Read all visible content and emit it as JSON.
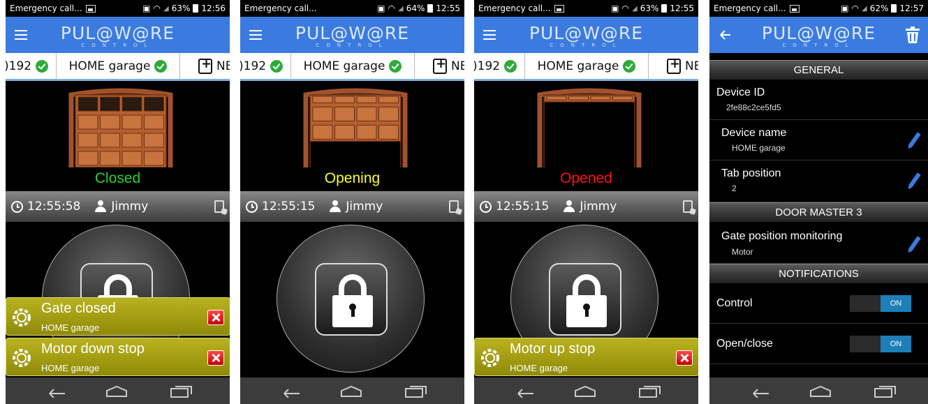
{
  "status_bar": {
    "carrier": "Emergency call...",
    "screens": [
      {
        "battery": "63%",
        "time": "12:56"
      },
      {
        "battery": "64%",
        "time": "12:55"
      },
      {
        "battery": "63%",
        "time": "12:55"
      },
      {
        "battery": "62%",
        "time": "12:57"
      }
    ]
  },
  "app": {
    "logo_main": "PUL@W@RE",
    "logo_sub": "CONTROL",
    "brand_color": "#3b7be0"
  },
  "tabs": {
    "left_partial": ")192",
    "active": "HOME garage",
    "right_partial": "NE"
  },
  "screens": [
    {
      "state": "Closed",
      "state_color": "#2bd12b",
      "door_open_fraction": 0,
      "time": "12:55:58",
      "user": "Jimmy",
      "notifications": [
        {
          "title": "Gate closed",
          "subtitle": "HOME garage"
        },
        {
          "title": "Motor down stop",
          "subtitle": "HOME garage"
        }
      ]
    },
    {
      "state": "Opening",
      "state_color": "#ffff1e",
      "door_open_fraction": 0.4,
      "time": "12:55:15",
      "user": "Jimmy",
      "notifications": []
    },
    {
      "state": "Opened",
      "state_color": "#ff1010",
      "door_open_fraction": 1,
      "time": "12:55:15",
      "user": "Jimmy",
      "notifications": [
        {
          "title": "Motor up stop",
          "subtitle": "HOME garage"
        }
      ]
    }
  ],
  "settings": {
    "general_header": "GENERAL",
    "device_id_label": "Device ID",
    "device_id_value": "2fe88c2ce5fd5",
    "device_name_label": "Device name",
    "device_name_value": "HOME garage",
    "tab_position_label": "Tab position",
    "tab_position_value": "2",
    "door_master_header": "DOOR MASTER 3",
    "gate_monitoring_label": "Gate position monitoring",
    "gate_monitoring_value": "Motor",
    "notifications_header": "NOTIFICATIONS",
    "control_label": "Control",
    "control_toggle": "ON",
    "open_close_label": "Open/close",
    "open_close_toggle": "ON"
  }
}
